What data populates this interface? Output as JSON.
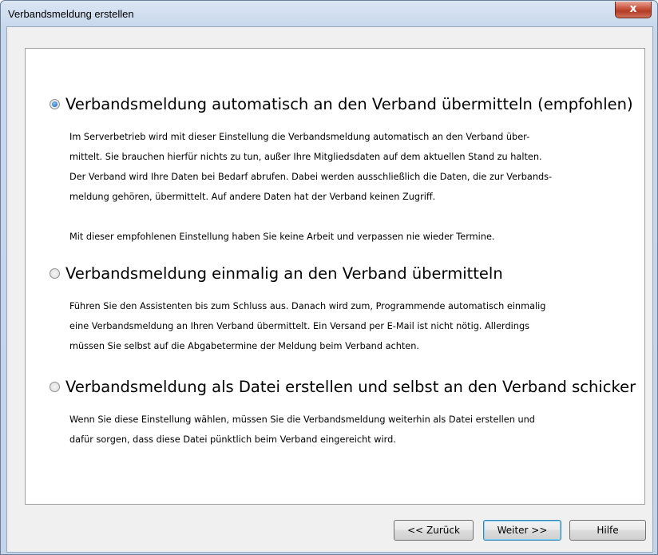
{
  "window": {
    "title": "Verbandsmeldung erstellen",
    "close_glyph": "x"
  },
  "options": [
    {
      "label": "Verbandsmeldung automatisch an den Verband übermitteln (empfohlen)",
      "checked": true,
      "paragraphs": [
        "Im Serverbetrieb wird mit dieser Einstellung die Verbandsmeldung automatisch an den Verband  über-",
        "mittelt. Sie brauchen hierfür nichts zu tun, außer Ihre Mitgliedsdaten auf dem aktuellen Stand zu halten.",
        "Der Verband wird Ihre Daten bei Bedarf abrufen. Dabei werden ausschließlich die Daten, die zur Verbands-",
        "meldung gehören, übermittelt. Auf andere Daten hat der Verband keinen Zugriff.",
        "",
        "Mit dieser empfohlenen Einstellung haben Sie keine Arbeit und verpassen nie wieder Termine."
      ]
    },
    {
      "label": "Verbandsmeldung einmalig an den Verband übermitteln",
      "checked": false,
      "paragraphs": [
        "Führen Sie den Assistenten bis zum Schluss aus. Danach wird zum, Programmende automatisch einmalig",
        "eine Verbandsmeldung an Ihren Verband übermittelt. Ein Versand per E-Mail ist nicht nötig. Allerdings",
        "müssen Sie selbst auf die Abgabetermine der Meldung beim Verband achten."
      ]
    },
    {
      "label": "Verbandsmeldung als Datei erstellen und selbst an den Verband schicker",
      "checked": false,
      "paragraphs": [
        "Wenn Sie diese Einstellung wählen, müssen Sie die Verbandsmeldung weiterhin als Datei erstellen und",
        "dafür sorgen, dass diese Datei pünktlich beim Verband eingereicht wird."
      ]
    }
  ],
  "buttons": {
    "back": "<< Zurück",
    "next": "Weiter >>",
    "help": "Hilfe"
  }
}
